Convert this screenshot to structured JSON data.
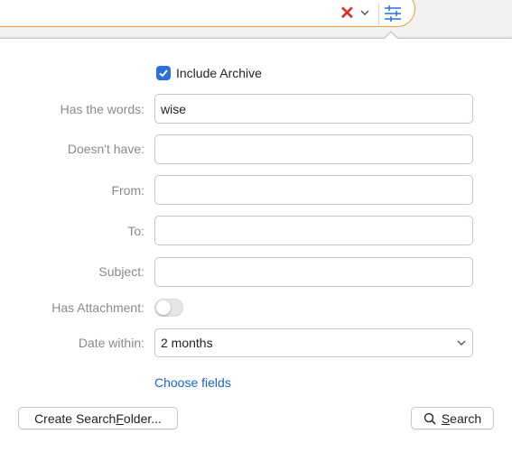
{
  "toolbar": {
    "clear_icon": "close-icon",
    "chevron_icon": "chevron-down-icon",
    "filter_icon": "sliders-icon",
    "accent_color": "#f0a030",
    "clear_color": "#e0302a"
  },
  "options": {
    "include_archive": {
      "label": "Include Archive",
      "checked": true
    }
  },
  "fields": {
    "has_words": {
      "label": "Has the words:",
      "value": "wise"
    },
    "doesnt_have": {
      "label": "Doesn't have:",
      "value": ""
    },
    "from": {
      "label": "From:",
      "value": ""
    },
    "to": {
      "label": "To:",
      "value": ""
    },
    "subject": {
      "label": "Subject:",
      "value": ""
    },
    "has_attachment": {
      "label": "Has Attachment:",
      "on": false
    },
    "date_within": {
      "label": "Date within:",
      "value": "2 months"
    }
  },
  "choose_fields_label": "Choose fields",
  "buttons": {
    "create_folder": {
      "pre": "Create Search ",
      "u": "F",
      "post": "older..."
    },
    "search": {
      "u": "S",
      "post": "earch",
      "icon": "search-icon"
    }
  },
  "link_color": "#1a63d0",
  "checkbox_color": "#2a6fdb"
}
